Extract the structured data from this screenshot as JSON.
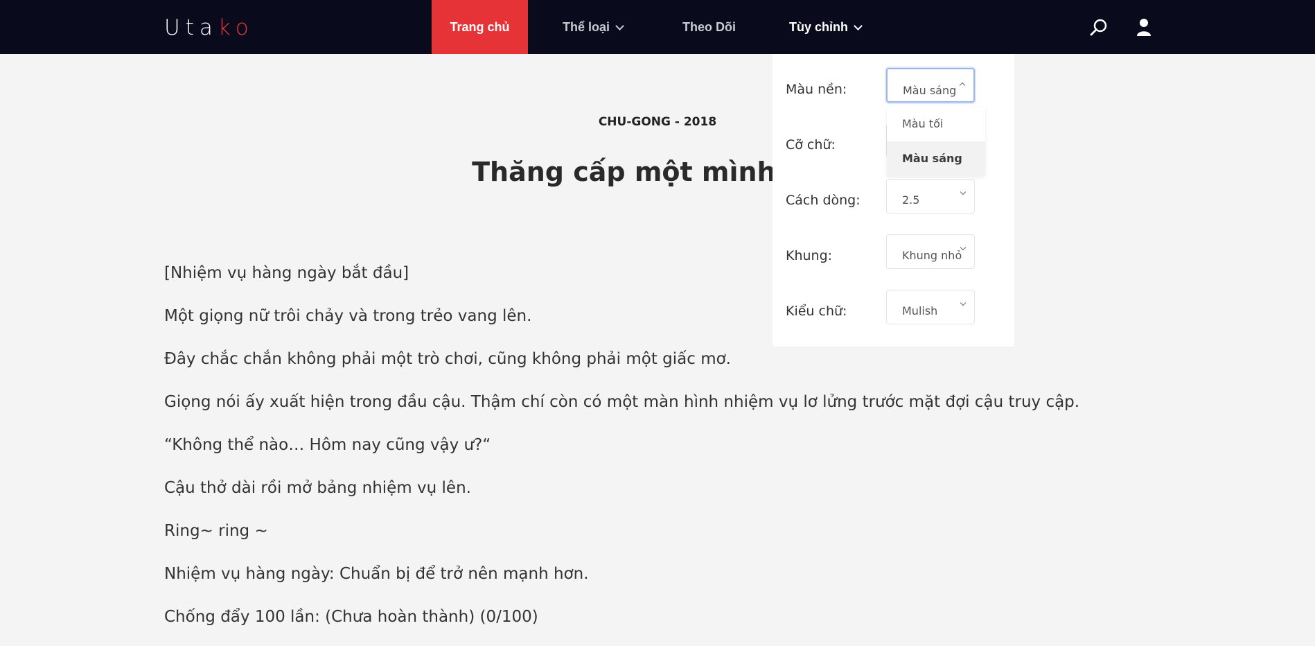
{
  "nav": {
    "logo_main": "Uta",
    "logo_accent": "ko",
    "items": [
      {
        "label": "Trang chủ"
      },
      {
        "label": "Thể loại"
      },
      {
        "label": "Theo Dõi"
      },
      {
        "label": "Tùy chỉnh"
      }
    ],
    "accent_color": "#e53337",
    "background_color": "#090b1d"
  },
  "chapter": {
    "meta": "CHU-GONG - 2018",
    "title": "Thăng cấp một mình - Ch",
    "paragraphs": [
      "[Nhiệm vụ hàng ngày bắt đầu]",
      "Một giọng nữ trôi chảy và trong trẻo vang lên.",
      "Đây chắc chắn không phải một trò chơi, cũng không phải một giấc mơ.",
      "Giọng nói ấy xuất hiện trong đầu cậu. Thậm chí còn có một màn hình nhiệm vụ lơ lửng trước mặt đợi cậu truy cập.",
      "“Không thể nào… Hôm nay cũng vậy ư?“",
      "Cậu thở dài rồi mở bảng nhiệm vụ lên.",
      "Ring~ ring ~",
      "Nhiệm vụ hàng ngày: Chuẩn bị để trở nên mạnh hơn.",
      "Chống đẩy 100 lần: (Chưa hoàn thành) (0/100)"
    ]
  },
  "settings": {
    "background": {
      "label": "Màu nền:",
      "value": "Màu sáng",
      "options": [
        "Màu tối",
        "Màu sáng"
      ]
    },
    "font_size": {
      "label": "Cỡ chữ:"
    },
    "line_spacing": {
      "label": "Cách dòng:",
      "value": "2.5"
    },
    "frame": {
      "label": "Khung:",
      "value": "Khung nhỏ"
    },
    "font_family": {
      "label": "Kiểu chữ:",
      "value": "Mulish"
    }
  }
}
